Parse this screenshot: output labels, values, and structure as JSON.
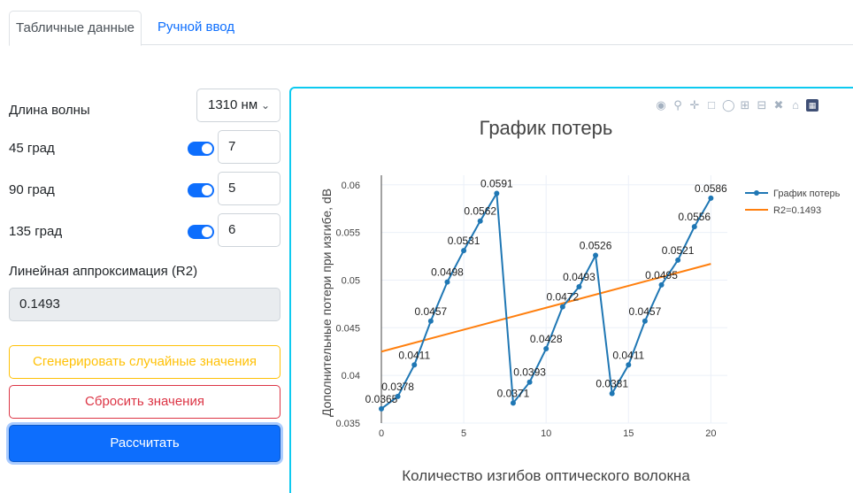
{
  "tabs": [
    {
      "label": "Табличные данные",
      "active": true
    },
    {
      "label": "Ручной ввод",
      "active": false
    }
  ],
  "form": {
    "wavelength_label": "Длина волны",
    "wavelength_value": "1310 нм",
    "rows": [
      {
        "label": "45 град",
        "enabled": true,
        "value": "7"
      },
      {
        "label": "90 град",
        "enabled": true,
        "value": "5"
      },
      {
        "label": "135 град",
        "enabled": true,
        "value": "6"
      }
    ],
    "r2_label": "Линейная аппроксимация (R2)",
    "r2_value": "0.1493",
    "generate_label": "Сгенерировать случайные значения",
    "reset_label": "Сбросить значения",
    "calculate_label": "Рассчитать"
  },
  "colors": {
    "primary": "#0d6efd",
    "series": "#1f77b4",
    "fit": "#ff7f0e",
    "panel_border": "#0dcaf0"
  },
  "modebar_icons": [
    "camera-icon",
    "zoom-icon",
    "pan-icon",
    "box-select-icon",
    "lasso-icon",
    "zoom-in-icon",
    "zoom-out-icon",
    "autoscale-icon",
    "home-icon",
    "plotly-logo-icon"
  ],
  "chart_data": {
    "type": "line",
    "title": "График потерь",
    "xlabel": "Количество изгибов оптического волокна",
    "ylabel": "Дополнительные потери при изгибе, dB",
    "xlim": [
      0,
      21
    ],
    "ylim": [
      0.035,
      0.061
    ],
    "x_ticks": [
      0,
      5,
      10,
      15,
      20
    ],
    "y_ticks": [
      0.035,
      0.04,
      0.045,
      0.05,
      0.055,
      0.06
    ],
    "x_tick_labels": [
      "0",
      "5",
      "10",
      "15",
      "20"
    ],
    "y_tick_labels": [
      "0.035",
      "0.04",
      "0.045",
      "0.05",
      "0.055",
      "0.06"
    ],
    "grid": true,
    "legend_position": "top-right",
    "series": [
      {
        "name": "График потерь",
        "mode": "lines+markers+text",
        "x": [
          0,
          1,
          2,
          3,
          4,
          5,
          6,
          7,
          8,
          9,
          10,
          11,
          12,
          13,
          14,
          15,
          16,
          17,
          18,
          19,
          20
        ],
        "values": [
          0.0365,
          0.0378,
          0.0411,
          0.0457,
          0.0498,
          0.0531,
          0.0562,
          0.0591,
          0.0371,
          0.0393,
          0.0428,
          0.0472,
          0.0493,
          0.0526,
          0.0381,
          0.0411,
          0.0457,
          0.0495,
          0.0521,
          0.0556,
          0.0586
        ],
        "labels": [
          "0.0365",
          "0.0378",
          "0.0411",
          "0.0457",
          "0.0498",
          "0.0531",
          "0.0562",
          "0.0591",
          "0.0371",
          "0.0393",
          "0.0428",
          "0.0472",
          "0.0493",
          "0.0526",
          "0.0381",
          "0.0411",
          "0.0457",
          "0.0495",
          "0.0521",
          "0.0556",
          "0.0586"
        ]
      },
      {
        "name": "R2=0.1493",
        "mode": "lines",
        "x": [
          0,
          20
        ],
        "values": [
          0.0425,
          0.0517
        ]
      }
    ]
  }
}
